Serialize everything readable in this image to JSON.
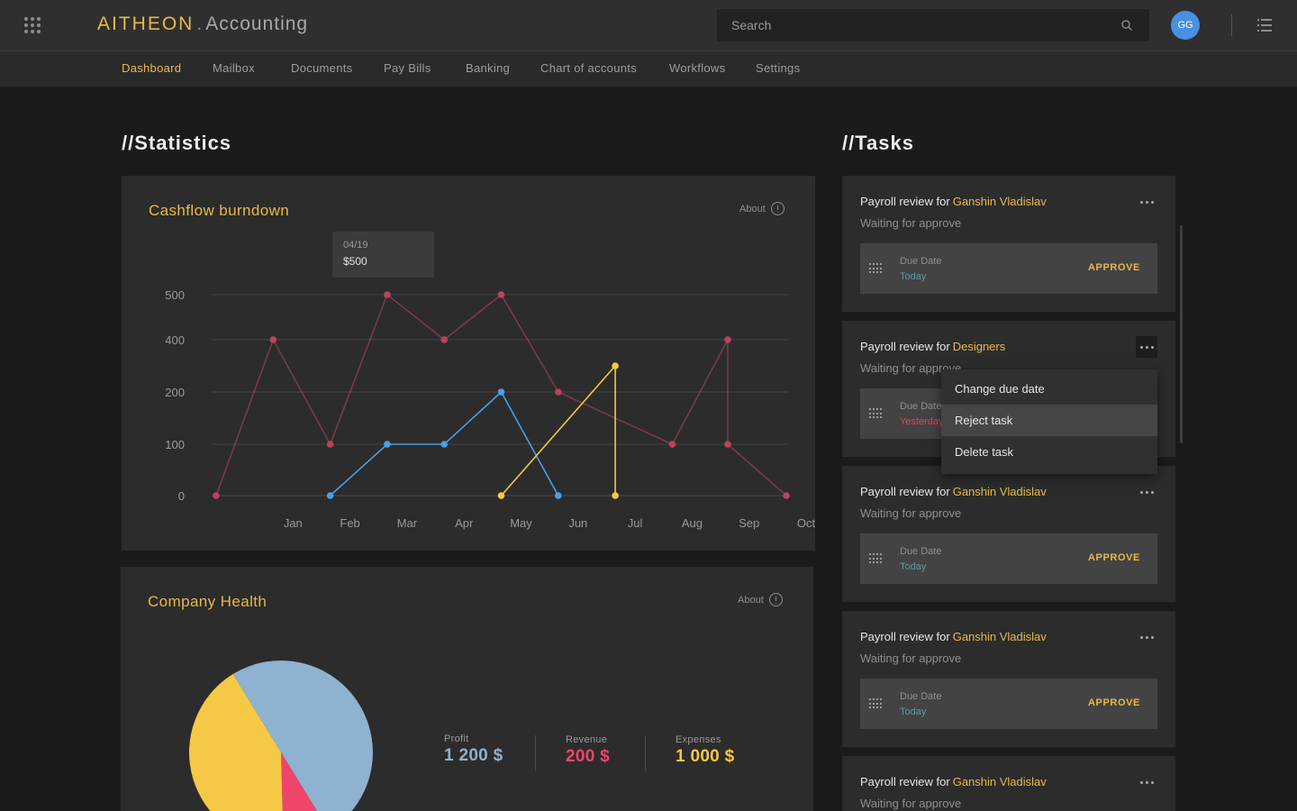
{
  "app": {
    "brand_name": "AITHEON",
    "brand_separator": ".",
    "brand_app": "Accounting",
    "search_placeholder": "Search",
    "user_initials": "GG"
  },
  "nav": {
    "items": [
      {
        "label": "Dashboard",
        "active": true
      },
      {
        "label": "Mailbox",
        "active": false
      },
      {
        "label": "Documents",
        "active": false
      },
      {
        "label": "Pay Bills",
        "active": false
      },
      {
        "label": "Banking",
        "active": false
      },
      {
        "label": "Chart of accounts",
        "active": false
      },
      {
        "label": "Workflows",
        "active": false
      },
      {
        "label": "Settings",
        "active": false
      }
    ]
  },
  "statistics": {
    "heading": "//Statistics",
    "cashflow": {
      "title": "Cashflow burndown",
      "about_label": "About",
      "tooltip": {
        "date": "04/19",
        "value": "$500"
      }
    },
    "company_health": {
      "title": "Company Health",
      "about_label": "About",
      "stats": [
        {
          "label": "Profit",
          "value": "1 200 $",
          "color": "#8eb2cf"
        },
        {
          "label": "Revenue",
          "value": "200 $",
          "color": "#f0456b"
        },
        {
          "label": "Expenses",
          "value": "1 000 $",
          "color": "#f5c845"
        }
      ]
    }
  },
  "tasks": {
    "heading": "//Tasks",
    "items": [
      {
        "title": "Payroll review for",
        "assignee": "Ganshin Vladislav",
        "status": "Waiting for approve",
        "due_label": "Due Date",
        "due_value": "Today",
        "due_state": "today",
        "action": "APPROVE"
      },
      {
        "title": "Payroll review for",
        "assignee": "Designers",
        "status": "Waiting for approve",
        "due_label": "Due Date",
        "due_value": "Yesterday",
        "due_state": "yesterday",
        "action": ""
      },
      {
        "title": "Payroll review for",
        "assignee": "Ganshin Vladislav",
        "status": "Waiting for approve",
        "due_label": "Due Date",
        "due_value": "Today",
        "due_state": "today",
        "action": "APPROVE"
      },
      {
        "title": "Payroll review for",
        "assignee": "Ganshin Vladislav",
        "status": "Waiting for approve",
        "due_label": "Due Date",
        "due_value": "Today",
        "due_state": "today",
        "action": "APPROVE"
      },
      {
        "title": "Payroll review for",
        "assignee": "Ganshin Vladislav",
        "status": "Waiting for approve",
        "due_label": "",
        "due_value": "",
        "due_state": "today",
        "action": ""
      }
    ],
    "menu": {
      "items": [
        {
          "label": "Change due date",
          "hover": false
        },
        {
          "label": "Reject task",
          "hover": true
        },
        {
          "label": "Delete task",
          "hover": false
        }
      ]
    }
  },
  "chart_data": [
    {
      "type": "line",
      "title": "Cashflow burndown",
      "categories": [
        "Jan",
        "Feb",
        "Mar",
        "Apr",
        "May",
        "Jun",
        "Jul",
        "Aug",
        "Sep",
        "Oct"
      ],
      "y_ticks": [
        0,
        100,
        200,
        400,
        500
      ],
      "y_scale": "categorical ticks (unevenly spaced)",
      "grid": true,
      "series": [
        {
          "color": "#c0405e",
          "points": [
            [
              "Dec",
              0
            ],
            [
              "Jan",
              400
            ],
            [
              "Feb",
              100
            ],
            [
              "Mar",
              500
            ],
            [
              "Apr",
              400
            ],
            [
              "May",
              500
            ],
            [
              "Jun",
              200
            ],
            [
              "Aug",
              100
            ],
            [
              "Sep",
              400
            ],
            [
              "Sep",
              100
            ],
            [
              "Oct",
              0
            ]
          ]
        },
        {
          "color": "#4a9fe6",
          "points": [
            [
              "Feb",
              0
            ],
            [
              "Mar",
              100
            ],
            [
              "Apr",
              100
            ],
            [
              "May",
              200
            ],
            [
              "Jun",
              0
            ]
          ]
        },
        {
          "color": "#f5c845",
          "points": [
            [
              "May",
              0
            ],
            [
              "Jul",
              300
            ],
            [
              "Jul",
              0
            ]
          ]
        }
      ]
    },
    {
      "type": "pie",
      "title": "Company Health",
      "slices": [
        {
          "label": "Profit",
          "value": 1200,
          "color": "#8eb2cf"
        },
        {
          "label": "Revenue",
          "value": 200,
          "color": "#f0456b"
        },
        {
          "label": "Expenses",
          "value": 1000,
          "color": "#f5c845"
        }
      ]
    }
  ]
}
